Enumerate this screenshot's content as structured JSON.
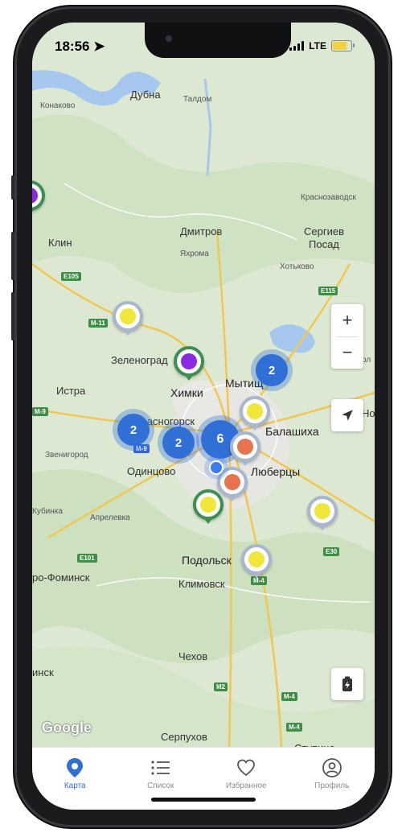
{
  "status": {
    "time": "18:56",
    "network": "LTE"
  },
  "map": {
    "cities": [
      {
        "name": "Дубна",
        "cls": ""
      },
      {
        "name": "Талдом",
        "cls": "small"
      },
      {
        "name": "Конаково",
        "cls": "small"
      },
      {
        "name": "Краснозаводск",
        "cls": "small"
      },
      {
        "name": "Клин",
        "cls": ""
      },
      {
        "name": "Дмитров",
        "cls": ""
      },
      {
        "name": "Яхрома",
        "cls": "small"
      },
      {
        "name": "Сергиев",
        "cls": ""
      },
      {
        "name": "Посад",
        "cls": ""
      },
      {
        "name": "Хотьково",
        "cls": "small"
      },
      {
        "name": "Зеленоград",
        "cls": ""
      },
      {
        "name": "Истра",
        "cls": ""
      },
      {
        "name": "Химки",
        "cls": "bold"
      },
      {
        "name": "Мытищ",
        "cls": "bold"
      },
      {
        "name": "Красногорск",
        "cls": ""
      },
      {
        "name": "Балашиха",
        "cls": "bold"
      },
      {
        "name": "Звенигород",
        "cls": "small"
      },
      {
        "name": "Одинцово",
        "cls": ""
      },
      {
        "name": "Люберцы",
        "cls": "bold"
      },
      {
        "name": "Кубинка",
        "cls": "small"
      },
      {
        "name": "Апрелевка",
        "cls": "small"
      },
      {
        "name": "ро-Фоминск",
        "cls": ""
      },
      {
        "name": "Подольск",
        "cls": "bold"
      },
      {
        "name": "Климовск",
        "cls": ""
      },
      {
        "name": "Чехов",
        "cls": ""
      },
      {
        "name": "инск",
        "cls": ""
      },
      {
        "name": "Серпухов",
        "cls": ""
      },
      {
        "name": "Ступино",
        "cls": ""
      },
      {
        "name": "Ног",
        "cls": ""
      },
      {
        "name": "ол",
        "cls": "small"
      }
    ],
    "roads": [
      "E105",
      "M-11",
      "E115",
      "M-9",
      "M-9",
      "E101",
      "E30",
      "M-4",
      "M2",
      "M-4",
      "M-4"
    ],
    "clusters": [
      "2",
      "2",
      "2",
      "6"
    ],
    "pins": [
      {
        "color": "#f1e63a",
        "ring": "gray"
      },
      {
        "color": "#8a2be2",
        "ring": "green"
      },
      {
        "color": "#f1e63a",
        "ring": "gray"
      },
      {
        "color": "#e8734f",
        "ring": "gray"
      },
      {
        "color": "#e8734f",
        "ring": "gray"
      },
      {
        "color": "#f1e63a",
        "ring": "green"
      },
      {
        "color": "#f1e63a",
        "ring": "gray"
      },
      {
        "color": "#f1e63a",
        "ring": "gray"
      }
    ],
    "zoom_in": "+",
    "zoom_out": "−",
    "attribution": "Google"
  },
  "tabs": [
    {
      "label": "Карта",
      "icon": "map-pin-icon",
      "active": true
    },
    {
      "label": "Список",
      "icon": "list-icon",
      "active": false
    },
    {
      "label": "Избранное",
      "icon": "heart-icon",
      "active": false
    },
    {
      "label": "Профиль",
      "icon": "profile-icon",
      "active": false
    }
  ],
  "colors": {
    "accent": "#2f6fd6",
    "cluster": "#2f6fd6",
    "green_ring": "#3b8f4f"
  }
}
